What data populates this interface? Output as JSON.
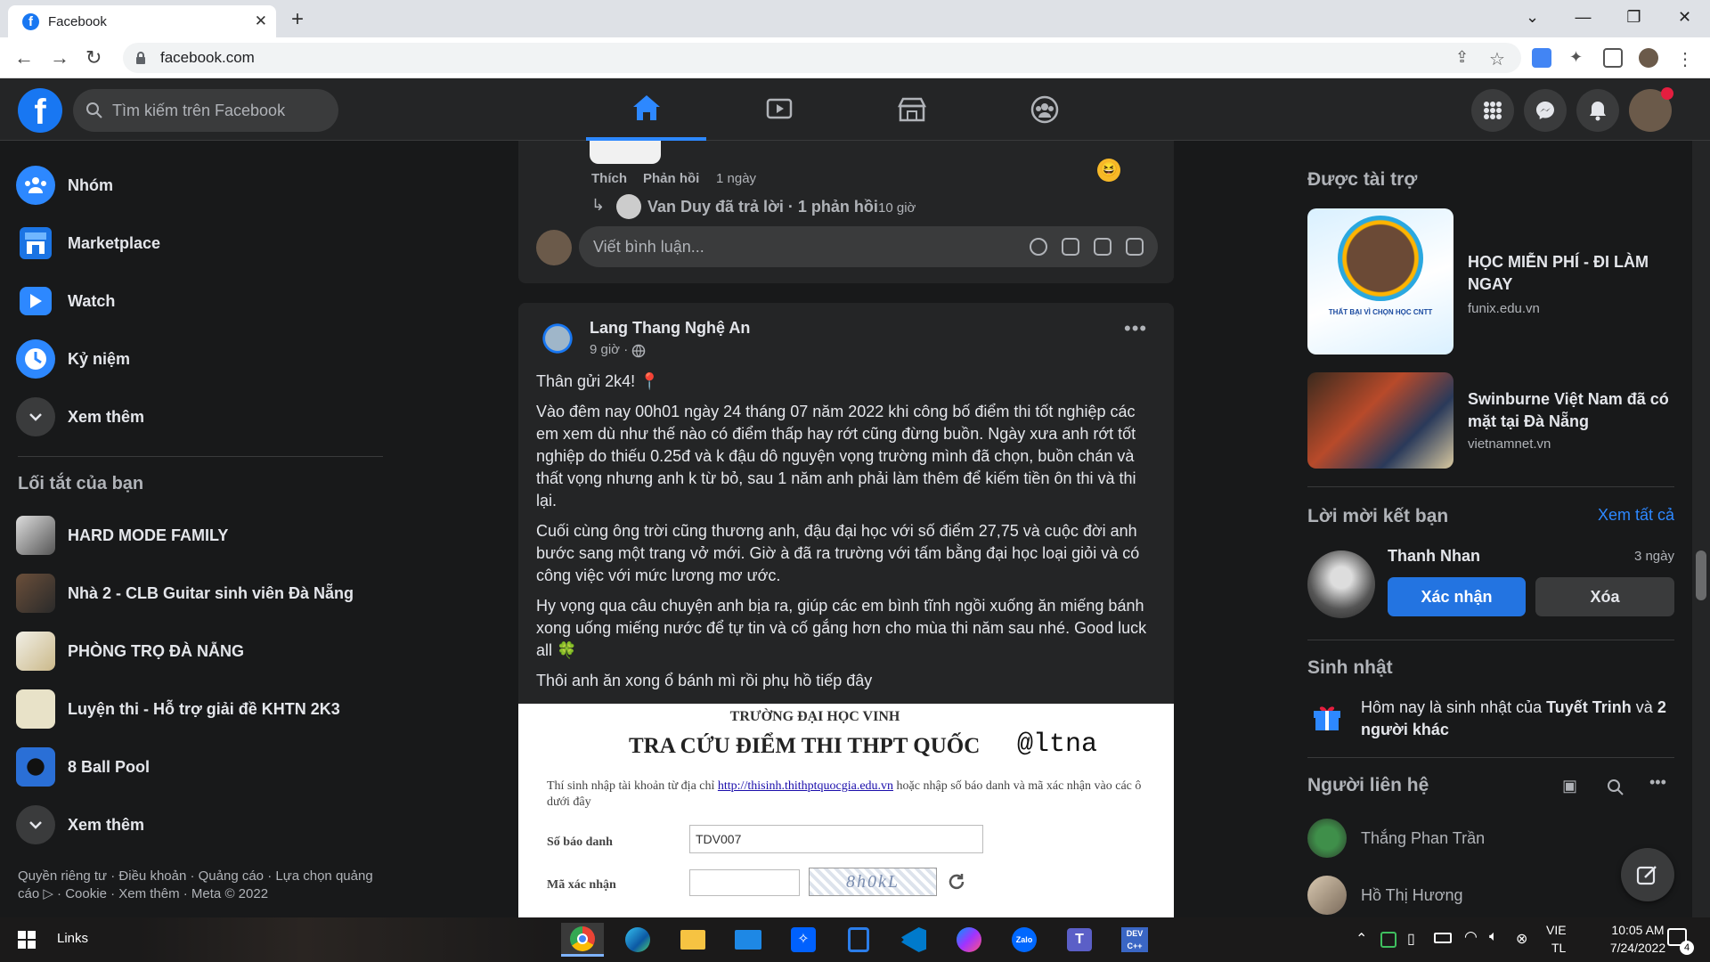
{
  "browser": {
    "tab_title": "Facebook",
    "url": "facebook.com"
  },
  "header": {
    "search_placeholder": "Tìm kiếm trên Facebook"
  },
  "sidebar": {
    "items": [
      {
        "label": "Nhóm"
      },
      {
        "label": "Marketplace"
      },
      {
        "label": "Watch"
      },
      {
        "label": "Kỷ niệm"
      },
      {
        "label": "Xem thêm"
      }
    ],
    "shortcuts_heading": "Lối tắt của bạn",
    "shortcuts": [
      {
        "label": "HARD MODE FAMILY"
      },
      {
        "label": "Nhà 2 - CLB Guitar sinh viên Đà Nẵng"
      },
      {
        "label": "PHÒNG TRỌ ĐÀ NẴNG"
      },
      {
        "label": "Luyện thi - Hỗ trợ giải đề KHTN 2K3"
      },
      {
        "label": "8 Ball Pool"
      }
    ],
    "shortcuts_more": "Xem thêm",
    "footer": "Quyền riêng tư · Điều khoản · Quảng cáo · Lựa chọn quảng cáo ▷ · Cookie · Xem thêm · Meta © 2022"
  },
  "comment": {
    "like": "Thích",
    "reply": "Phản hồi",
    "time": "1 ngày",
    "reply_author": "Van Duy đã trả lời · 1 phản hồi",
    "reply_time": "10 giờ",
    "input_placeholder": "Viết bình luận..."
  },
  "post": {
    "author": "Lang Thang Nghệ An",
    "time": "9 giờ ·",
    "p1": "Thân gửi 2k4! 📍",
    "p2": "Vào đêm nay 00h01 ngày 24 tháng 07 năm 2022 khi công bố điểm thi tốt nghiệp các em xem dù như thế nào có điểm thấp hay rớt cũng đừng buồn. Ngày xưa anh rớt tốt nghiệp do thiếu 0.25đ và k đậu dô nguyện vọng trường mình đã chọn, buồn chán và thất vọng nhưng anh k từ bỏ, sau 1 năm anh phải làm thêm để kiếm tiền ôn thi và thi lại.",
    "p3": "Cuối cùng ông trời cũng thương anh, đậu đại học với số điểm 27,75 và cuộc đời anh bước sang một trang vở mới. Giờ à đã ra trường với tấm bằng đại học loại giỏi và có công việc với mức lương mơ ước.",
    "p4": "Hy vọng qua câu chuyện anh bịa ra, giúp các em bình tĩnh ngồi xuống ăn miếng bánh xong uống miếng nước để tự tin và cố gắng hơn cho mùa thi năm sau nhé. Good luck all 🍀",
    "p5": "Thôi anh ăn xong ổ bánh mì rồi phụ hồ tiếp đây",
    "image": {
      "school": "TRƯỜNG ĐẠI HỌC VINH",
      "title": "TRA CỨU ĐIỂM THI THPT QUỐC",
      "watermark": "@ltna",
      "instruction_pre": "Thí sinh nhập tài khoản từ địa chỉ",
      "instruction_link": "http://thisinh.thithptquocgia.edu.vn",
      "instruction_post": "hoặc nhập số báo danh và mã xác nhận vào các ô dưới đây",
      "sbd_label": "Số báo danh",
      "sbd_value": "TDV007",
      "captcha_label": "Mã xác nhận",
      "captcha_value": "8h0kL"
    }
  },
  "right": {
    "sponsored_heading": "Được tài trợ",
    "ads": [
      {
        "title": "HỌC MIỄN PHÍ - ĐI LÀM NGAY",
        "domain": "funix.edu.vn",
        "img_caption": "THẤT BẠI VÌ CHỌN HỌC CNTT"
      },
      {
        "title": "Swinburne Việt Nam đã có mặt tại Đà Nẵng",
        "domain": "vietnamnet.vn"
      }
    ],
    "friend_heading": "Lời mời kết bạn",
    "see_all": "Xem tất cả",
    "friend": {
      "name": "Thanh Nhan",
      "time": "3 ngày",
      "confirm": "Xác nhận",
      "delete": "Xóa"
    },
    "birthday_heading": "Sinh nhật",
    "birthday_pre": "Hôm nay là sinh nhật của ",
    "birthday_name": "Tuyết Trinh",
    "birthday_mid": " và ",
    "birthday_others": "2 người khác",
    "contacts_heading": "Người liên hệ",
    "contacts": [
      {
        "name": "Thắng Phan Trần"
      },
      {
        "name": "Hồ Thị Hương"
      }
    ]
  },
  "taskbar": {
    "search": "Links",
    "lang1": "VIE",
    "lang2": "TL",
    "time": "10:05 AM",
    "date": "7/24/2022",
    "notif": "4"
  },
  "colors": {
    "fb_blue": "#1877f2",
    "bg": "#18191a",
    "card": "#242526",
    "accent": "#2d88ff"
  }
}
